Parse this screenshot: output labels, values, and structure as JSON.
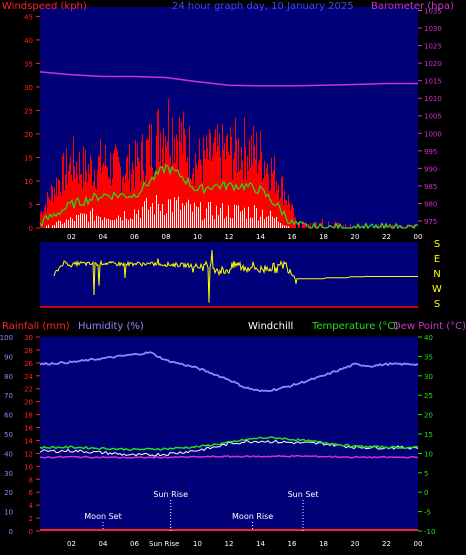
{
  "header": {
    "wind_label": "Windspeed (kph)",
    "title": "24 hour graph day, 10 January 2025",
    "baro_label": "Barometer (hpa)"
  },
  "row_labels": {
    "rain": "Rainfall (mm)",
    "humidity": "Humidity (%)",
    "windchill": "Windchill",
    "temperature": "Temperature (°C)",
    "dewpoint": "Dew Point (°C)"
  },
  "compass": [
    "S",
    "E",
    "N",
    "W",
    "S"
  ],
  "x_ticks": [
    "02",
    "04",
    "06",
    "08",
    "10",
    "12",
    "14",
    "16",
    "18",
    "20",
    "22",
    "00"
  ],
  "astro": {
    "moon_set": "Moon Set",
    "sun_rise": "Sun Rise",
    "moon_rise": "Moon Rise",
    "sun_set": "Sun Set",
    "sun_rise_axis": "Sun Rise"
  },
  "colors": {
    "bg_panel": "#00007a",
    "wind": "#ff0000",
    "gust_avg": "#22dd22",
    "white": "#ffffff",
    "baro": "#cc33cc",
    "direction": "#ffff00",
    "humidity": "#8888ff",
    "temp": "#22dd22",
    "dew": "#cc33cc",
    "rain": "#ff2222"
  },
  "chart_data": [
    {
      "type": "area",
      "name": "wind-baro",
      "x_range": [
        0,
        24
      ],
      "wind_ticks": [
        0,
        5,
        10,
        15,
        20,
        25,
        30,
        35,
        40,
        45
      ],
      "wind_ylim": [
        0,
        47
      ],
      "baro_ticks": [
        975,
        980,
        985,
        990,
        995,
        1000,
        1005,
        1010,
        1015,
        1020,
        1025,
        1030,
        1035
      ],
      "baro_ylim": [
        973,
        1036
      ],
      "barometer": {
        "x": [
          0,
          2,
          4,
          6,
          8,
          10,
          12,
          14,
          16,
          18,
          20,
          22,
          24
        ],
        "y": [
          1017.5,
          1016.7,
          1016.2,
          1016.2,
          1015.9,
          1014.7,
          1013.7,
          1013.5,
          1013.5,
          1013.7,
          1013.9,
          1014.2,
          1014.2
        ]
      },
      "wind_gust_envelope": {
        "x": [
          0,
          0.5,
          1,
          2,
          3,
          4,
          5,
          6,
          7,
          8,
          8.5,
          9,
          10,
          11,
          12,
          13,
          14,
          15,
          15.5,
          16,
          16.2,
          17,
          18,
          19,
          20,
          21,
          22,
          23,
          24
        ],
        "y": [
          4,
          8,
          12,
          18,
          16,
          18,
          16,
          17,
          22,
          29,
          27,
          24,
          18,
          20,
          21,
          22,
          20,
          14,
          10,
          5,
          2,
          1,
          2,
          1,
          1,
          0.5,
          1,
          1,
          0.5
        ]
      },
      "wind_avg": {
        "x": [
          0,
          1,
          2,
          3,
          4,
          5,
          6,
          7,
          8,
          9,
          10,
          11,
          12,
          13,
          14,
          15,
          16,
          17,
          18,
          20,
          24
        ],
        "y": [
          1,
          3,
          5,
          6,
          7,
          7,
          7,
          10,
          13,
          11,
          8,
          9,
          9,
          9,
          8,
          5,
          1,
          0,
          0,
          0,
          0
        ]
      },
      "wind_lull": {
        "x": [
          0,
          1,
          2,
          3,
          4,
          5,
          6,
          7,
          8,
          9,
          10,
          11,
          12,
          13,
          14,
          15,
          16,
          17,
          24
        ],
        "y": [
          0,
          1,
          2,
          3,
          3,
          3,
          4,
          5,
          6,
          5,
          4,
          4,
          4,
          4,
          4,
          2,
          0,
          0,
          0
        ]
      }
    },
    {
      "type": "line",
      "name": "wind-direction",
      "x_range": [
        0,
        24
      ],
      "direction": {
        "x": [
          0.9,
          1.5,
          2,
          2.5,
          3,
          3.5,
          4,
          5,
          6,
          7,
          8,
          9,
          10,
          11,
          11.5,
          12,
          12.5,
          13,
          13.5,
          14,
          14.5,
          15,
          15.5,
          16,
          16.2,
          16.5,
          18,
          18.2,
          19.5,
          19.7,
          20.5,
          20.7,
          24
        ],
        "y": [
          180,
          250,
          235,
          245,
          240,
          240,
          245,
          240,
          242,
          240,
          238,
          235,
          230,
          225,
          200,
          210,
          240,
          215,
          230,
          205,
          225,
          215,
          240,
          200,
          160,
          160,
          160,
          165,
          165,
          170,
          170,
          172,
          172
        ]
      }
    },
    {
      "type": "line",
      "name": "temperature-humidity",
      "x_range": [
        0,
        24
      ],
      "rain_ticks": [
        0,
        2,
        4,
        6,
        8,
        10,
        12,
        14,
        16,
        18,
        20,
        22,
        24,
        26,
        28,
        30
      ],
      "humidity_ticks": [
        0,
        10,
        20,
        30,
        40,
        50,
        60,
        70,
        80,
        90,
        100
      ],
      "temp_ticks": [
        -10,
        -5,
        0,
        5,
        10,
        15,
        20,
        25,
        30,
        35,
        40
      ],
      "temp_ylim": [
        -10,
        40
      ],
      "humidity": {
        "x": [
          0,
          2,
          4,
          6,
          7,
          8,
          10,
          12,
          13,
          14,
          15,
          16,
          18,
          20,
          21,
          22,
          24
        ],
        "y": [
          86,
          87,
          89,
          91,
          92,
          88,
          84,
          78,
          74,
          72,
          73,
          75,
          80,
          86,
          85,
          86,
          86
        ]
      },
      "temperature": {
        "x": [
          0,
          2,
          4,
          6,
          8,
          10,
          12,
          13,
          14,
          15,
          16,
          18,
          20,
          22,
          24
        ],
        "y": [
          11.5,
          11.6,
          11.3,
          11.0,
          11.2,
          11.7,
          12.8,
          13.5,
          14.0,
          14.0,
          13.6,
          12.8,
          11.8,
          11.6,
          11.5
        ]
      },
      "windchill": {
        "x": [
          0,
          2,
          4,
          6,
          8,
          10,
          11,
          12,
          13,
          14,
          15,
          16,
          18,
          20,
          22,
          24
        ],
        "y": [
          10.5,
          10.7,
          10.2,
          9.5,
          9.8,
          10.8,
          11.5,
          12.5,
          13.0,
          13.2,
          13.0,
          12.8,
          12.5,
          11.6,
          11.5,
          11.5
        ]
      },
      "dewpoint": {
        "x": [
          0,
          2,
          4,
          6,
          8,
          10,
          12,
          14,
          16,
          18,
          20,
          22,
          24
        ],
        "y": [
          9.0,
          9.1,
          9.0,
          8.9,
          9.0,
          9.1,
          9.2,
          9.2,
          9.3,
          9.2,
          9.0,
          9.0,
          9.0
        ]
      },
      "rainfall": {
        "x": [
          0,
          24
        ],
        "y": [
          0,
          0
        ]
      },
      "events": [
        {
          "label_key": "moon_set",
          "x": 4.0
        },
        {
          "label_key": "sun_rise",
          "x": 8.3
        },
        {
          "label_key": "moon_rise",
          "x": 13.5
        },
        {
          "label_key": "sun_set",
          "x": 16.7
        }
      ]
    }
  ]
}
